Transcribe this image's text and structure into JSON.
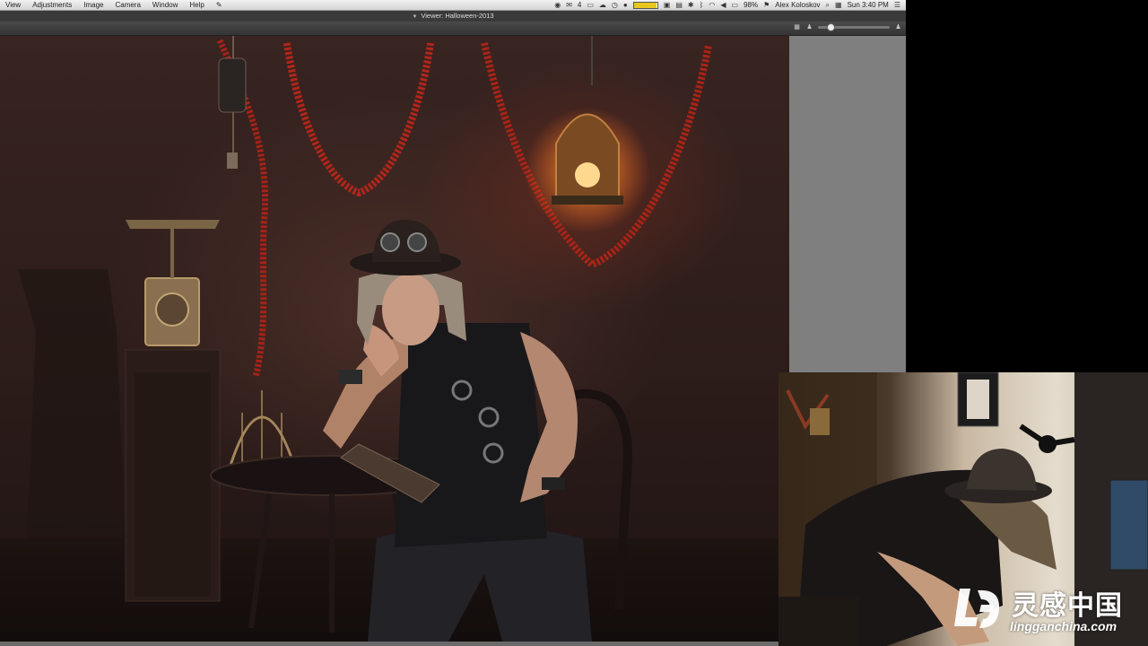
{
  "menubar": {
    "items": [
      "View",
      "Adjustments",
      "Image",
      "Camera",
      "Window",
      "Help"
    ],
    "status_badge": "4",
    "battery_percent": "98%",
    "battery_level": 0.98,
    "user_name": "Alex Koloskov",
    "clock": "Sun 3:40 PM"
  },
  "viewer": {
    "title": "Viewer: Halloween-2013",
    "zoom_level": 0.18
  },
  "colors": {
    "menubar_bg": "#e0e0e0",
    "window_chrome": "#3a3a3a",
    "viewer_bg": "#7f7f7f",
    "photo_backdrop": "#2c1c1a",
    "tinsel": "#b2261a",
    "lantern_glow": "#ff9a3c"
  },
  "watermark": {
    "brand_cn": "灵感中国",
    "url": "lingganchina.com"
  }
}
